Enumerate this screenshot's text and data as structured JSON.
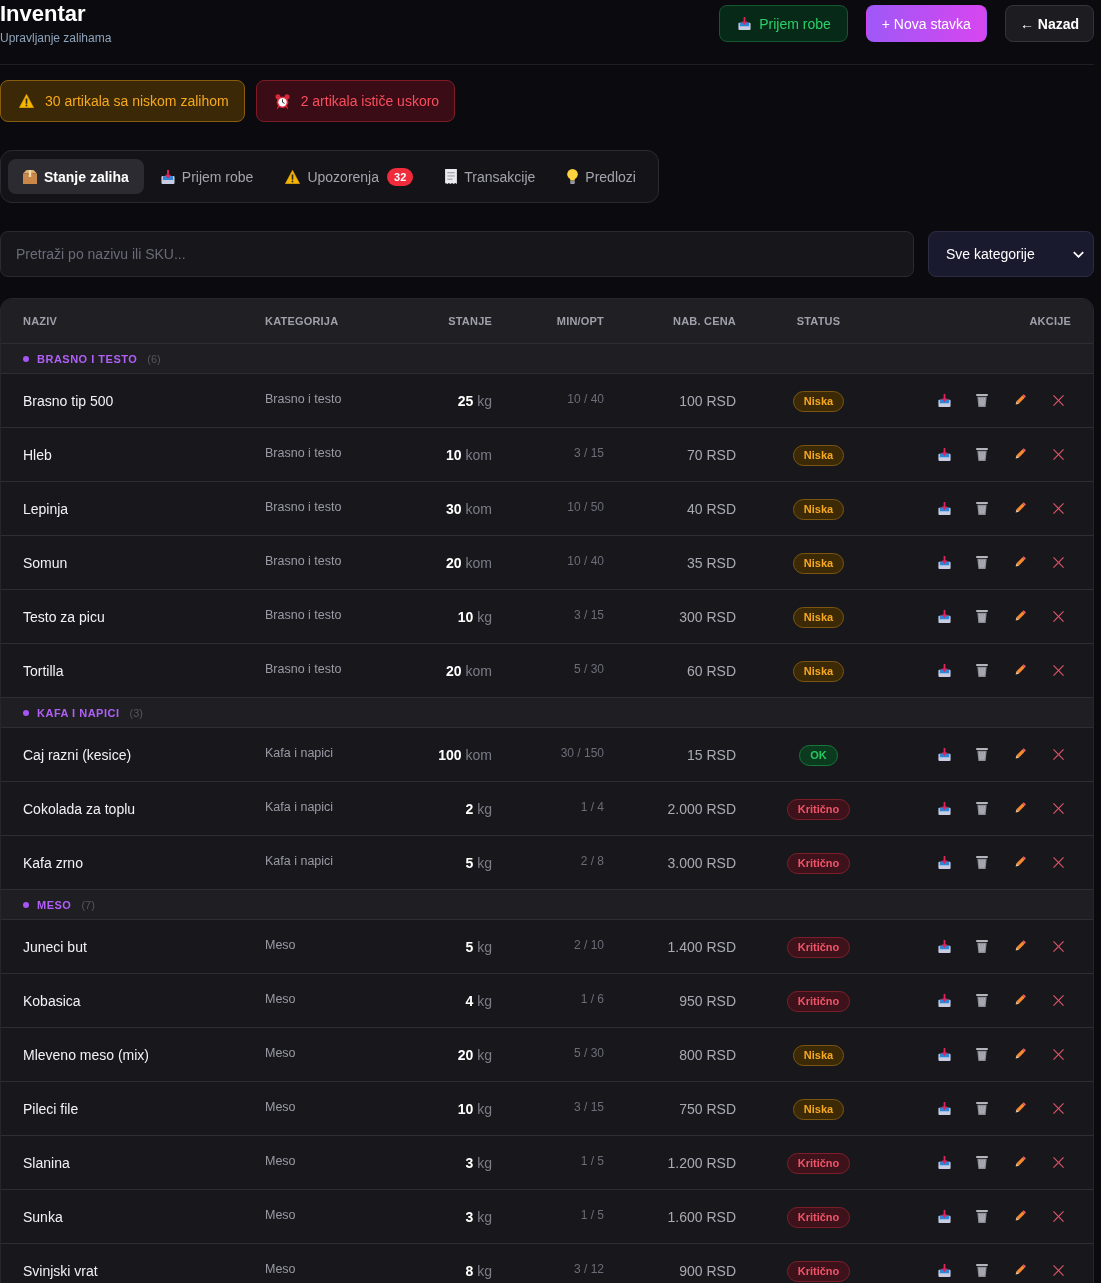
{
  "header": {
    "title": "Inventar",
    "subtitle": "Upravljanje zalihama",
    "buttons": [
      {
        "label": "Prijem robe",
        "kind": "receive"
      },
      {
        "label": "+ Nova stavka",
        "kind": "primary"
      },
      {
        "label": "← Nazad",
        "kind": "back"
      }
    ]
  },
  "alerts": [
    {
      "text": "30 artikala sa niskom zalihom",
      "kind": "low-stock"
    },
    {
      "text": "2 artikala ističe uskoro",
      "kind": "expiring"
    }
  ],
  "tabs": [
    {
      "label": "Stanje zaliha",
      "kind": "stock",
      "selected": true
    },
    {
      "label": "Prijem robe",
      "kind": "receive",
      "selected": false
    },
    {
      "label": "Upozorenja",
      "kind": "alerts",
      "selected": false,
      "badge": "32"
    },
    {
      "label": "Transakcije",
      "kind": "transactions",
      "selected": false
    },
    {
      "label": "Predlozi",
      "kind": "suggestions",
      "selected": false
    }
  ],
  "search": {
    "placeholder": "Pretraži po nazivu ili SKU..."
  },
  "category_filter": {
    "value": "Sve kategorije"
  },
  "table": {
    "columns": [
      "NAZIV",
      "KATEGORIJA",
      "STANJE",
      "MIN/OPT",
      "NAB. CENA",
      "STATUS",
      "AKCIJE"
    ],
    "groups": [
      {
        "name": "BRASNO I TESTO",
        "count": "(6)",
        "rows": [
          {
            "name": "Brasno tip 500",
            "category": "Brasno i testo",
            "stock": "**25** kg",
            "min_opt": "10 / 40",
            "price": "100 RSD",
            "status": {
              "label": "Niska",
              "kind": "low"
            }
          },
          {
            "name": "Hleb",
            "category": "Brasno i testo",
            "stock": "**10** kom",
            "min_opt": "3 / 15",
            "price": "70 RSD",
            "status": {
              "label": "Niska",
              "kind": "low"
            }
          },
          {
            "name": "Lepinja",
            "category": "Brasno i testo",
            "stock": "**30** kom",
            "min_opt": "10 / 50",
            "price": "40 RSD",
            "status": {
              "label": "Niska",
              "kind": "low"
            }
          },
          {
            "name": "Somun",
            "category": "Brasno i testo",
            "stock": "**20** kom",
            "min_opt": "10 / 40",
            "price": "35 RSD",
            "status": {
              "label": "Niska",
              "kind": "low"
            }
          },
          {
            "name": "Testo za picu",
            "category": "Brasno i testo",
            "stock": "**10** kg",
            "min_opt": "3 / 15",
            "price": "300 RSD",
            "status": {
              "label": "Niska",
              "kind": "low"
            }
          },
          {
            "name": "Tortilla",
            "category": "Brasno i testo",
            "stock": "**20** kom",
            "min_opt": "5 / 30",
            "price": "60 RSD",
            "status": {
              "label": "Niska",
              "kind": "low"
            }
          }
        ]
      },
      {
        "name": "KAFA I NAPICI",
        "count": "(3)",
        "rows": [
          {
            "name": "Caj razni (kesice)",
            "category": "Kafa i napici",
            "stock": "**100** kom",
            "min_opt": "30 / 150",
            "price": "15 RSD",
            "status": {
              "label": "OK",
              "kind": "ok"
            }
          },
          {
            "name": "Cokolada za toplu",
            "category": "Kafa i napici",
            "stock": "**2** kg",
            "min_opt": "1 / 4",
            "price": "2.000 RSD",
            "status": {
              "label": "Kritično",
              "kind": "critical"
            }
          },
          {
            "name": "Kafa zrno",
            "category": "Kafa i napici",
            "stock": "**5** kg",
            "min_opt": "2 / 8",
            "price": "3.000 RSD",
            "status": {
              "label": "Kritično",
              "kind": "critical"
            }
          }
        ]
      },
      {
        "name": "MESO",
        "count": "(7)",
        "rows": [
          {
            "name": "Juneci but",
            "category": "Meso",
            "stock": "**5** kg",
            "min_opt": "2 / 10",
            "price": "1.400 RSD",
            "status": {
              "label": "Kritično",
              "kind": "critical"
            }
          },
          {
            "name": "Kobasica",
            "category": "Meso",
            "stock": "**4** kg",
            "min_opt": "1 / 6",
            "price": "950 RSD",
            "status": {
              "label": "Kritično",
              "kind": "critical"
            }
          },
          {
            "name": "Mleveno meso (mix)",
            "category": "Meso",
            "stock": "**20** kg",
            "min_opt": "5 / 30",
            "price": "800 RSD",
            "status": {
              "label": "Niska",
              "kind": "low"
            }
          },
          {
            "name": "Pileci file",
            "category": "Meso",
            "stock": "**10** kg",
            "min_opt": "3 / 15",
            "price": "750 RSD",
            "status": {
              "label": "Niska",
              "kind": "low"
            }
          },
          {
            "name": "Slanina",
            "category": "Meso",
            "stock": "**3** kg",
            "min_opt": "1 / 5",
            "price": "1.200 RSD",
            "status": {
              "label": "Kritično",
              "kind": "critical"
            }
          },
          {
            "name": "Sunka",
            "category": "Meso",
            "stock": "**3** kg",
            "min_opt": "1 / 5",
            "price": "1.600 RSD",
            "status": {
              "label": "Kritično",
              "kind": "critical"
            }
          },
          {
            "name": "Svinjski vrat",
            "category": "Meso",
            "stock": "**8** kg",
            "min_opt": "3 / 12",
            "price": "900 RSD",
            "status": {
              "label": "Kritično",
              "kind": "critical"
            }
          }
        ]
      }
    ]
  }
}
